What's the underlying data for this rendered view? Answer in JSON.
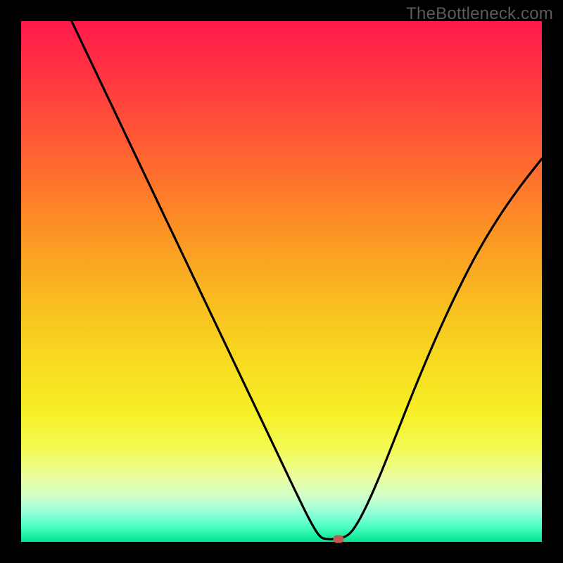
{
  "watermark": "TheBottleneck.com",
  "chart_data": {
    "type": "line",
    "title": "",
    "xlabel": "",
    "ylabel": "",
    "xlim": [
      0,
      1
    ],
    "ylim": [
      0,
      1
    ],
    "series": [
      {
        "name": "curve",
        "points": [
          {
            "x": 0.097,
            "y": 1.0
          },
          {
            "x": 0.135,
            "y": 0.92
          },
          {
            "x": 0.175,
            "y": 0.836
          },
          {
            "x": 0.215,
            "y": 0.752
          },
          {
            "x": 0.255,
            "y": 0.668
          },
          {
            "x": 0.295,
            "y": 0.584
          },
          {
            "x": 0.335,
            "y": 0.5
          },
          {
            "x": 0.375,
            "y": 0.416
          },
          {
            "x": 0.415,
            "y": 0.332
          },
          {
            "x": 0.455,
            "y": 0.248
          },
          {
            "x": 0.495,
            "y": 0.164
          },
          {
            "x": 0.525,
            "y": 0.101
          },
          {
            "x": 0.55,
            "y": 0.05
          },
          {
            "x": 0.565,
            "y": 0.023
          },
          {
            "x": 0.575,
            "y": 0.01
          },
          {
            "x": 0.585,
            "y": 0.006
          },
          {
            "x": 0.604,
            "y": 0.006
          },
          {
            "x": 0.627,
            "y": 0.013
          },
          {
            "x": 0.645,
            "y": 0.035
          },
          {
            "x": 0.665,
            "y": 0.073
          },
          {
            "x": 0.69,
            "y": 0.13
          },
          {
            "x": 0.72,
            "y": 0.205
          },
          {
            "x": 0.755,
            "y": 0.293
          },
          {
            "x": 0.795,
            "y": 0.388
          },
          {
            "x": 0.835,
            "y": 0.475
          },
          {
            "x": 0.875,
            "y": 0.553
          },
          {
            "x": 0.915,
            "y": 0.62
          },
          {
            "x": 0.955,
            "y": 0.678
          },
          {
            "x": 1.0,
            "y": 0.736
          }
        ]
      }
    ],
    "marker": {
      "x": 0.61,
      "y": 0.006
    },
    "colors": {
      "curve_stroke": "#000000",
      "marker_fill": "#c25a52",
      "background_gradient_top": "#ff1a4b",
      "background_gradient_bottom": "#00e48e",
      "frame": "#000000",
      "watermark": "#5b5b5b"
    }
  }
}
